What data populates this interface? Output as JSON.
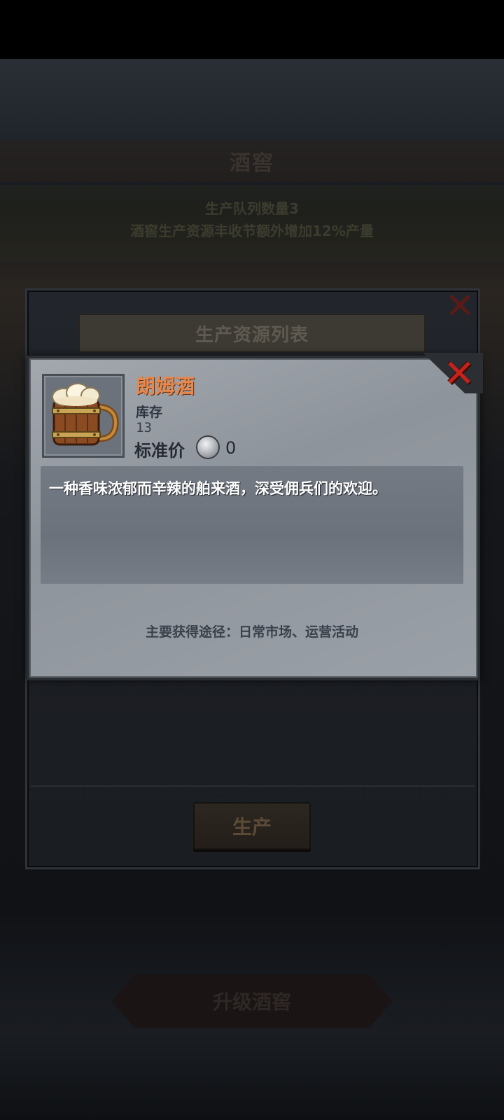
{
  "background": {
    "title": "酒窖",
    "queue_info": "生产队列数量3",
    "bonus_info": "酒窖生产资源丰收节额外增加12%产量",
    "upgrade_button": "升级酒窖"
  },
  "list_panel": {
    "title": "生产资源列表",
    "produce_button": "生产"
  },
  "item_detail": {
    "name": "朗姆酒",
    "stock_label": "库存",
    "stock_value": "13",
    "price_label": "标准价",
    "price_value": "0",
    "description": "一种香味浓郁而辛辣的舶来酒，深受佣兵们的欢迎。",
    "source": "主要获得途径：日常市场、运营活动",
    "icon": "beer-mug-icon",
    "currency_icon": "silver-coin-icon"
  },
  "colors": {
    "item_name": "#e8874a",
    "close_x": "#c4231b",
    "panel_bg": "#9aa0a7"
  }
}
